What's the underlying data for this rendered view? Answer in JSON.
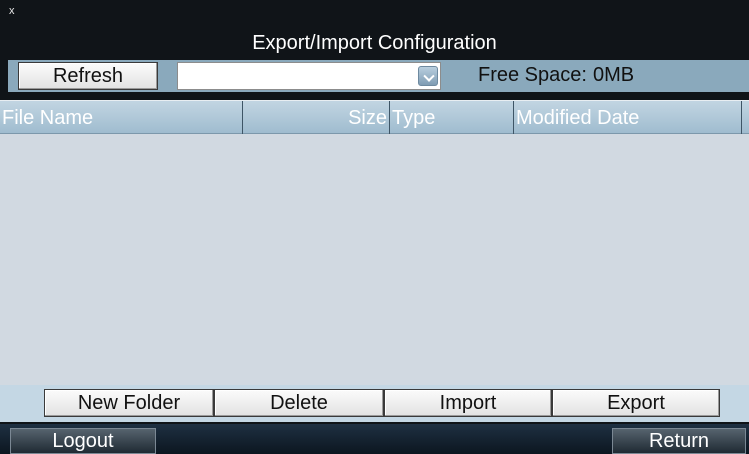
{
  "title": {
    "close_glyph": "x",
    "text": "Export/Import Configuration"
  },
  "toolbar": {
    "refresh_label": "Refresh",
    "device_select_value": "",
    "free_space_label": "Free Space:",
    "free_space_value": "0MB"
  },
  "file_list": {
    "columns": [
      "File Name",
      "Size",
      "Type",
      "Modified Date"
    ],
    "rows": []
  },
  "actions": {
    "new_folder_label": "New Folder",
    "delete_label": "Delete",
    "import_label": "Import",
    "export_label": "Export"
  },
  "taskbar": {
    "logout_label": "Logout",
    "return_label": "Return"
  },
  "icons": {
    "close": "close-icon",
    "dropdown": "chevron-down-icon"
  }
}
